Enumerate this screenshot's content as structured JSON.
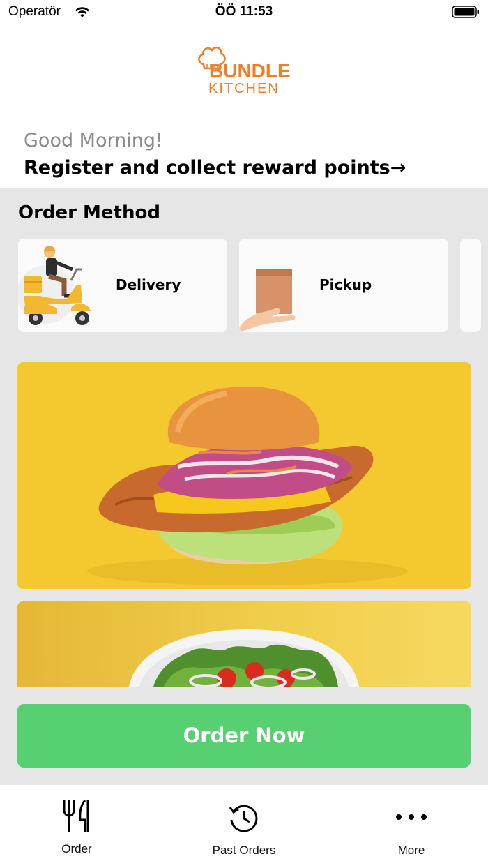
{
  "status_bar": {
    "carrier": "Operatör",
    "time": "ÖÖ 11:53"
  },
  "brand": {
    "line1": "BUNDLE",
    "line2": "KITCHEN",
    "color": "#f07e26"
  },
  "header": {
    "greeting": "Good Morning!",
    "register_prompt": "Register and collect reward points→"
  },
  "order_method": {
    "title": "Order Method",
    "options": [
      {
        "label": "Delivery",
        "icon": "scooter-delivery-icon"
      },
      {
        "label": "Pickup",
        "icon": "pickup-bag-icon"
      }
    ]
  },
  "promos": [
    {
      "name": "burger-promo-image"
    },
    {
      "name": "salad-promo-image"
    }
  ],
  "cta": {
    "label": "Order Now",
    "color": "#57d072"
  },
  "tab_bar": {
    "tabs": [
      {
        "label": "Order",
        "icon": "fork-knife-icon"
      },
      {
        "label": "Past Orders",
        "icon": "history-icon"
      },
      {
        "label": "More",
        "icon": "more-dots-icon"
      }
    ]
  }
}
